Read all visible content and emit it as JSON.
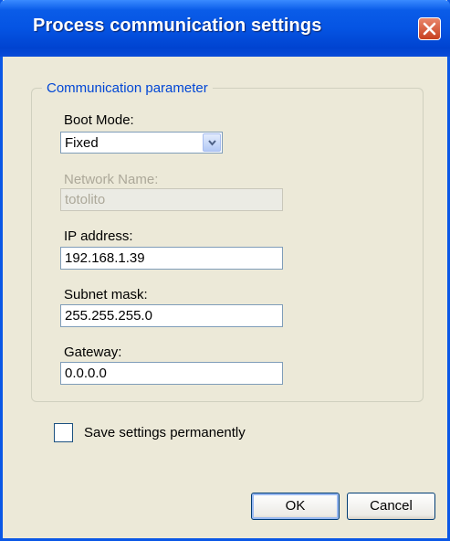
{
  "window": {
    "title": "Process communication settings"
  },
  "group": {
    "legend": "Communication parameter"
  },
  "boot_mode": {
    "label": "Boot Mode:",
    "selected": "Fixed"
  },
  "network_name": {
    "label": "Network Name:",
    "value": "totolito",
    "enabled": false
  },
  "ip_address": {
    "label": "IP address:",
    "value": "192.168.1.39"
  },
  "subnet_mask": {
    "label": "Subnet mask:",
    "value": "255.255.255.0"
  },
  "gateway": {
    "label": "Gateway:",
    "value": "0.0.0.0"
  },
  "save_permanently": {
    "label": "Save settings permanently",
    "checked": false
  },
  "buttons": {
    "ok": "OK",
    "cancel": "Cancel"
  },
  "colors": {
    "titlebar": "#0554e3",
    "dialog_bg": "#ece9d8",
    "group_legend": "#0046d5",
    "close_button": "#d3542f"
  },
  "icons": {
    "close": "close-icon",
    "dropdown": "chevron-down-icon"
  }
}
